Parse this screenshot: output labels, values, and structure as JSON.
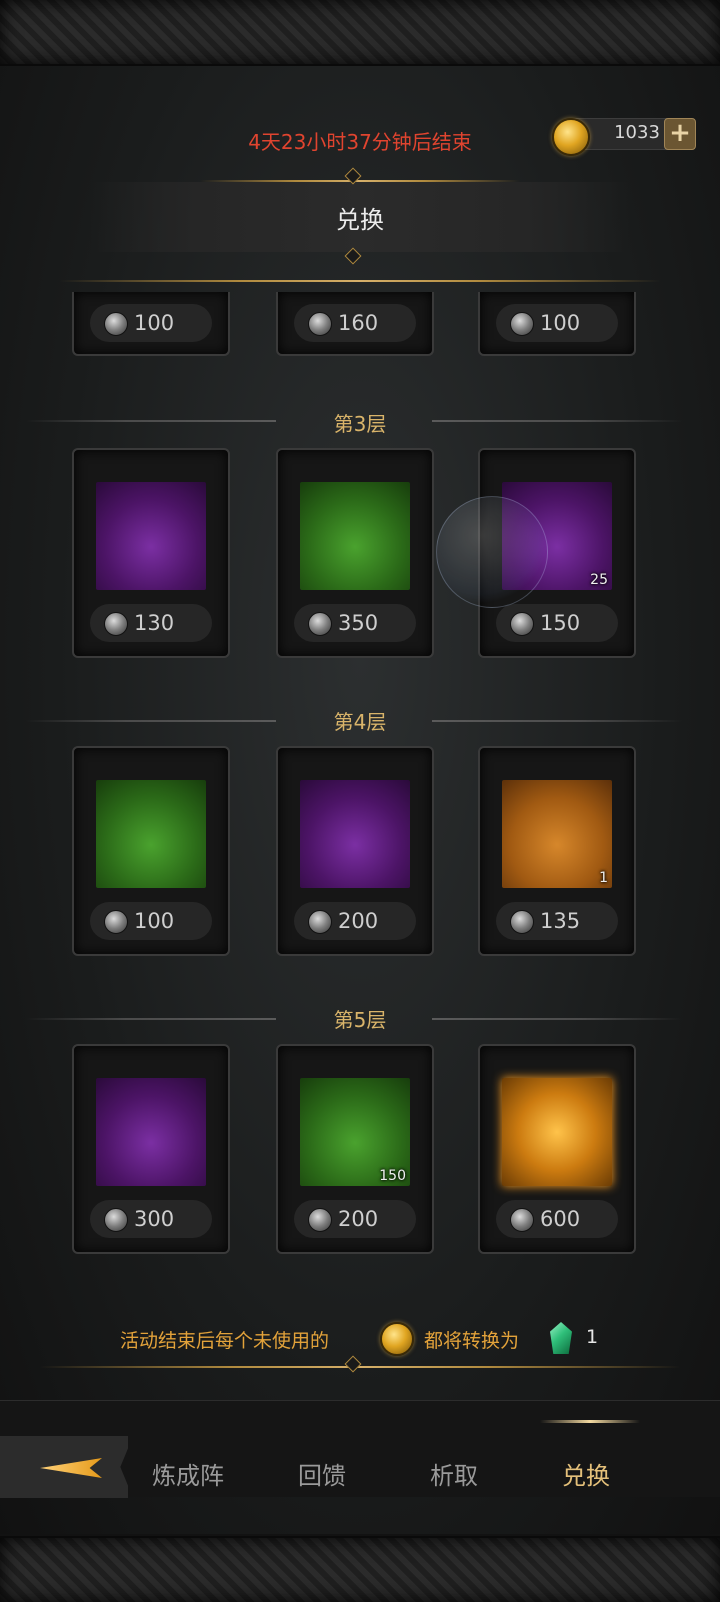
{
  "header": {
    "timer_text": "4天23小时37分钟后结束",
    "currency_amount": "1033",
    "currency_icon": "gold-coin-icon",
    "add_icon": "plus-icon"
  },
  "banner": {
    "title": "兑换"
  },
  "top_row_prices": [
    "100",
    "160",
    "100"
  ],
  "tiers": [
    {
      "label": "第3层",
      "items": [
        {
          "name": "treasure-chest",
          "bg": "purple",
          "price": "130",
          "qty": ""
        },
        {
          "name": "spiked-armor",
          "bg": "green",
          "price": "350",
          "qty": ""
        },
        {
          "name": "silver-chest",
          "bg": "purple",
          "price": "150",
          "qty": "25"
        }
      ]
    },
    {
      "label": "第4层",
      "items": [
        {
          "name": "pyramid-relic",
          "bg": "green",
          "price": "100",
          "qty": ""
        },
        {
          "name": "treasure-chest",
          "bg": "purple",
          "price": "200",
          "qty": ""
        },
        {
          "name": "purple-chest",
          "bg": "orange",
          "price": "135",
          "qty": "1"
        }
      ]
    },
    {
      "label": "第5层",
      "items": [
        {
          "name": "treasure-chest",
          "bg": "purple",
          "price": "300",
          "qty": ""
        },
        {
          "name": "green-potion",
          "bg": "green",
          "price": "200",
          "qty": "150"
        },
        {
          "name": "crystal-chest",
          "bg": "gold",
          "price": "600",
          "qty": ""
        }
      ]
    }
  ],
  "footer": {
    "text_before": "活动结束后每个未使用的",
    "text_middle": "都将转换为",
    "convert_amount": "1"
  },
  "tabs": [
    "炼成阵",
    "回馈",
    "析取",
    "兑换"
  ],
  "colors": {
    "timer": "#e0442f",
    "tier_label": "#d9b46a",
    "active_tab": "#e4c07a",
    "footer_text": "#e2a23a"
  }
}
